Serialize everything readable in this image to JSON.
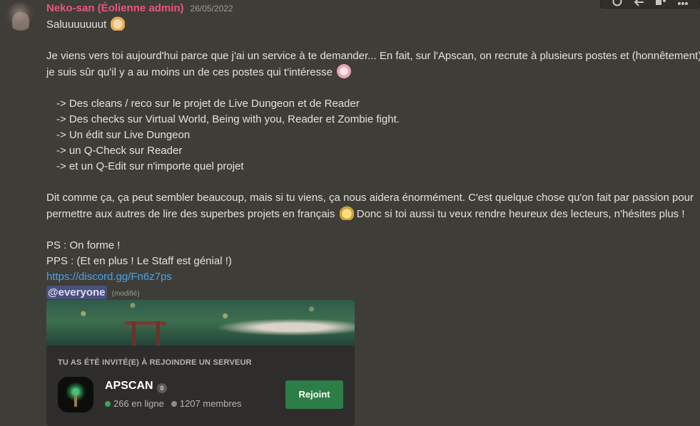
{
  "toolbar": {
    "icons": [
      "reaction-icon",
      "reply-icon",
      "thread-icon",
      "more-icon"
    ]
  },
  "message": {
    "username": "Neko-san (Éolienne admin)",
    "timestamp": "26/05/2022",
    "greeting": "Saluuuuuuut",
    "para1_line1": "Je viens vers toi aujourd'hui parce que j'ai un service à te demander... En fait, sur l'Apscan, on recrute à plusieurs postes et (honnêtement)",
    "para1_line2": "je suis sûr qu'il y a au moins un de ces postes qui t'intéresse",
    "list": [
      "-> Des cleans / reco sur le projet de Live Dungeon et de Reader",
      "-> Des checks sur Virtual World, Being with you, Reader et Zombie fight.",
      "-> Un édit sur Live Dungeon",
      "-> un Q-Check sur Reader",
      "-> et un Q-Edit sur n'importe quel projet"
    ],
    "para2_line1": "Dit comme ça, ça peut sembler beaucoup, mais si tu viens, ça nous aidera énormément. C'est quelque chose qu'on fait par passion pour",
    "para2_line2a": "permettre aux autres de lire des superbes projets en français",
    "para2_line2b": "Donc si toi aussi tu veux rendre heureux des lecteurs, n'hésites plus !",
    "ps1": "PS : On forme !",
    "ps2": "PPS : (Et en plus ! Le Staff est génial !)",
    "link": "https://discord.gg/Fn6z7ps",
    "mention": "@everyone",
    "edited": "(modifié)"
  },
  "invite": {
    "title": "TU AS ÉTÉ INVITÉ(E) À REJOINDRE UN SERVEUR",
    "server_name": "APSCAN",
    "badge": "0",
    "online": "266 en ligne",
    "members": "1207 membres",
    "button": "Rejoint",
    "colors": {
      "button": "#2d7d46",
      "online_dot": "#3ba55d"
    }
  },
  "colors": {
    "username": "#e8567a",
    "link": "#4aa3e8",
    "background": "#3f3d38"
  }
}
